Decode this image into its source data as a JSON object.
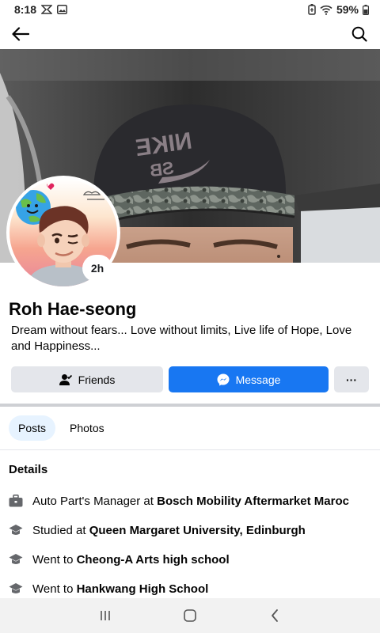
{
  "status_bar": {
    "time": "8:18",
    "battery": "59%"
  },
  "profile": {
    "name": "Roh Hae-seong",
    "bio": "Dream without fears...  Love without limits, Live life of Hope, Love and Happiness...",
    "story_time": "2h"
  },
  "actions": {
    "friends_label": "Friends",
    "message_label": "Message",
    "more_label": "···"
  },
  "tabs": [
    {
      "label": "Posts",
      "active": true
    },
    {
      "label": "Photos",
      "active": false
    }
  ],
  "details": {
    "title": "Details",
    "items": [
      {
        "icon": "briefcase-icon",
        "prefix": "Auto Part's Manager at ",
        "value": "Bosch Mobility Aftermarket Maroc"
      },
      {
        "icon": "graduation-cap-icon",
        "prefix": "Studied at ",
        "value": "Queen Margaret University, Edinburgh"
      },
      {
        "icon": "graduation-cap-icon",
        "prefix": "Went to ",
        "value": "Cheong-A Arts high school"
      },
      {
        "icon": "graduation-cap-icon",
        "prefix": "Went to ",
        "value": "Hankwang High School"
      }
    ]
  },
  "colors": {
    "primary": "#1877f2",
    "button_gray": "#e4e6eb",
    "active_tab": "#e7f3ff"
  }
}
